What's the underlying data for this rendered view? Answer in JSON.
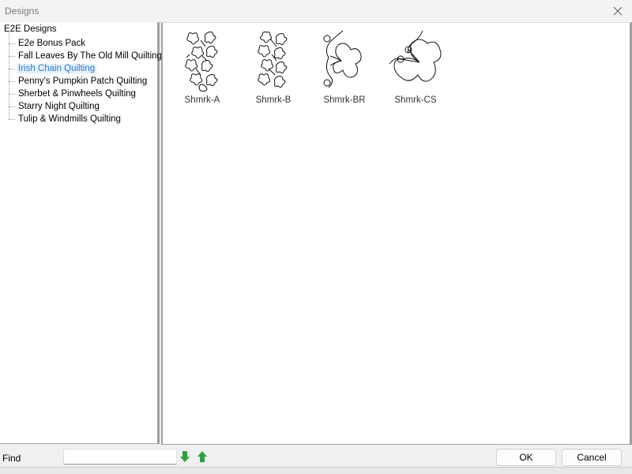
{
  "window": {
    "title": "Designs"
  },
  "tree": {
    "root": "E2E Designs",
    "items": [
      {
        "label": "E2e Bonus Pack",
        "selected": false
      },
      {
        "label": "Fall Leaves By The Old Mill Quilting",
        "selected": false
      },
      {
        "label": "Irish Chain Quilting",
        "selected": true
      },
      {
        "label": "Penny's Pumpkin Patch Quilting",
        "selected": false
      },
      {
        "label": "Sherbet & Pinwheels Quilting",
        "selected": false
      },
      {
        "label": "Starry Night Quilting",
        "selected": false
      },
      {
        "label": "Tulip & Windmills Quilting",
        "selected": false
      }
    ]
  },
  "designs": [
    {
      "name": "Shmrk-A",
      "icon": "shamrock-pattern-dense"
    },
    {
      "name": "Shmrk-B",
      "icon": "shamrock-pattern-dense"
    },
    {
      "name": "Shmrk-BR",
      "icon": "shamrock-border"
    },
    {
      "name": "Shmrk-CS",
      "icon": "shamrock-corner"
    }
  ],
  "footer": {
    "find_label": "Find",
    "find_value": "",
    "find_next_icon": "arrow-down-green",
    "find_prev_icon": "arrow-up-green",
    "ok_label": "OK",
    "cancel_label": "Cancel",
    "arrow_color": "#2ea043"
  }
}
